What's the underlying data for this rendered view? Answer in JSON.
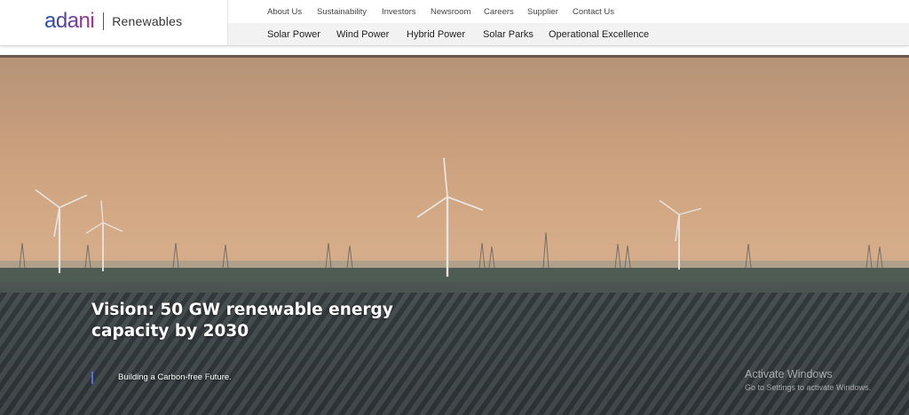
{
  "brand": {
    "name": "adani",
    "sub": "Renewables"
  },
  "top_nav": [
    "About Us",
    "Sustainability",
    "Investors",
    "Newsroom",
    "Careers",
    "Supplier",
    "Contact Us"
  ],
  "main_nav": [
    "Solar Power",
    "Wind Power",
    "Hybrid Power",
    "Solar Parks",
    "Operational Excellence"
  ],
  "hero": {
    "headline_line1": "Vision: 50 GW renewable energy",
    "headline_line2": "capacity by 2030",
    "tagline": "Building a Carbon-free Future."
  },
  "watermark": {
    "title": "Activate Windows",
    "subtitle": "Go to Settings to activate Windows."
  },
  "colors": {
    "brand_blue": "#1a4ea5",
    "brand_magenta": "#b0328c",
    "accent_bar": "#5b6fd6"
  }
}
